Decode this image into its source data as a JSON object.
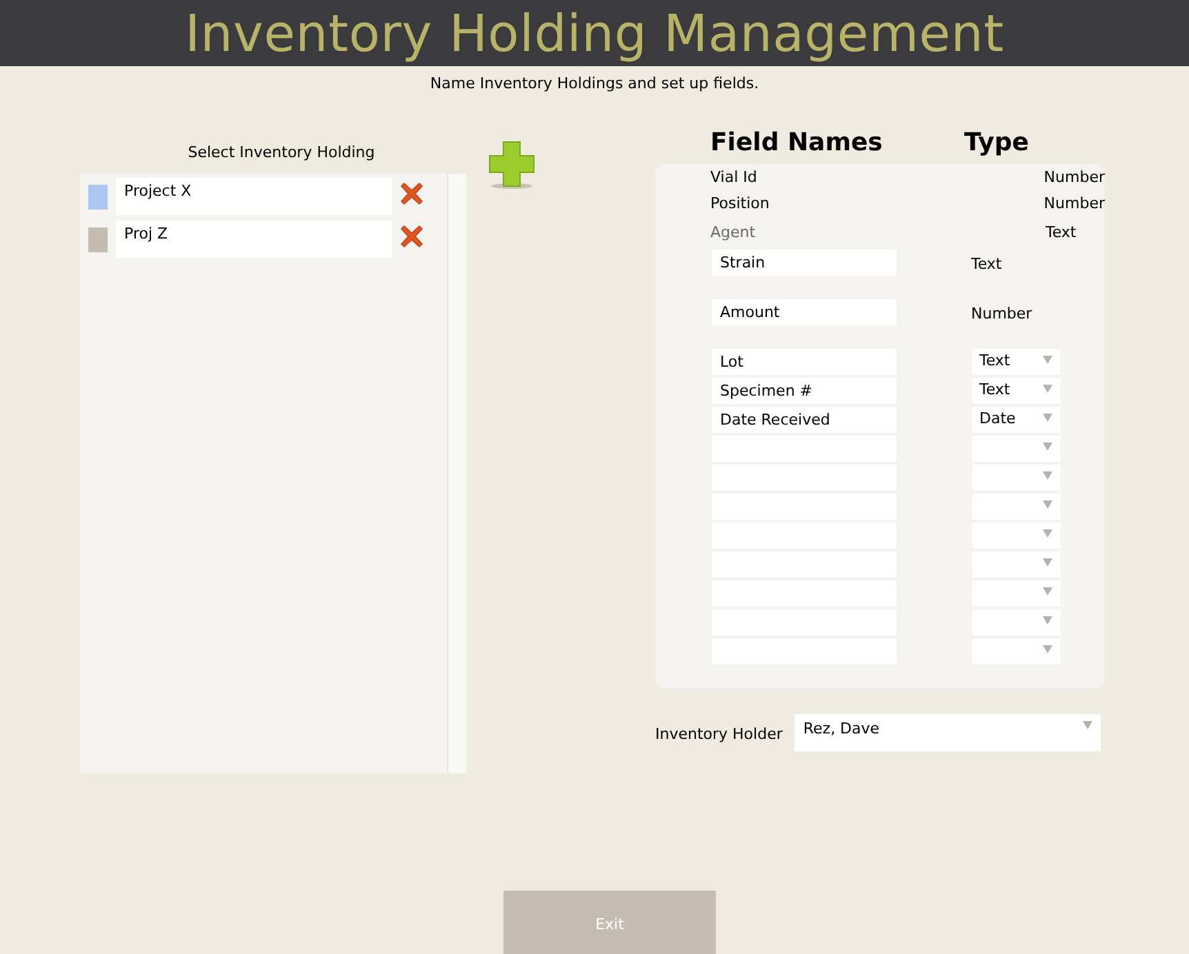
{
  "header": {
    "title": "Inventory Holding Management"
  },
  "subtitle": "Name Inventory Holdings and set up fields.",
  "holdings": {
    "label": "Select Inventory Holding",
    "items": [
      {
        "name": "Project X",
        "color": "#aec6f2"
      },
      {
        "name": "Proj Z",
        "color": "#c4bcb1"
      }
    ]
  },
  "fields": {
    "name_heading": "Field Names",
    "type_heading": "Type",
    "rows": [
      {
        "kind": "fixed",
        "name": "Vial Id",
        "type": "Number"
      },
      {
        "kind": "fixed",
        "name": "Position",
        "type": "Number"
      },
      {
        "kind": "dimmed",
        "name": "Agent",
        "type": "Text"
      },
      {
        "kind": "named",
        "name": "Strain",
        "type": "Text"
      },
      {
        "kind": "named",
        "name": "Amount",
        "type": "Number"
      },
      {
        "kind": "editable",
        "name": "Lot",
        "type": "Text"
      },
      {
        "kind": "editable",
        "name": "Specimen #",
        "type": "Text"
      },
      {
        "kind": "editable",
        "name": "Date Received",
        "type": "Date"
      },
      {
        "kind": "editable"
      },
      {
        "kind": "editable"
      },
      {
        "kind": "editable"
      },
      {
        "kind": "editable"
      },
      {
        "kind": "editable"
      },
      {
        "kind": "editable"
      },
      {
        "kind": "editable"
      },
      {
        "kind": "editable"
      }
    ]
  },
  "holder": {
    "label": "Inventory Holder",
    "value": "Rez, Dave"
  },
  "exit_button": "Exit"
}
